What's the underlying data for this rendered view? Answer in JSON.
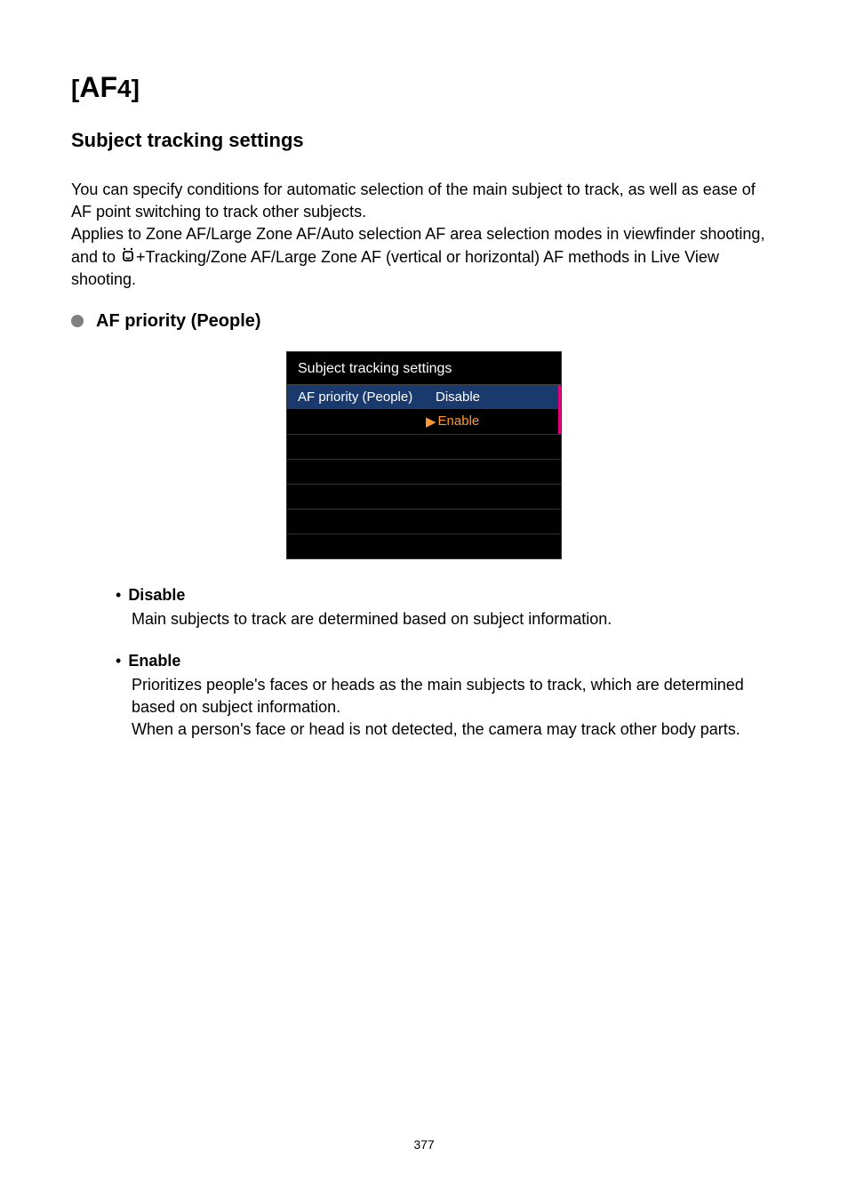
{
  "title": {
    "bracket_open": "[",
    "af": "AF",
    "num": "4",
    "bracket_close": "]"
  },
  "section_heading": "Subject tracking settings",
  "intro_para1": "You can specify conditions for automatic selection of the main subject to track, as well as ease of AF point switching to track other subjects.",
  "intro_para2_a": "Applies to Zone AF/Large Zone AF/Auto selection AF area selection modes in viewfinder shooting, and to ",
  "intro_para2_b": "+Tracking/Zone AF/Large Zone AF (vertical or horizontal) AF methods in Live View shooting.",
  "subsection_title": "AF priority (People)",
  "camera_menu": {
    "title": "Subject tracking settings",
    "row_label": "AF priority (People)",
    "option_disable": "Disable",
    "option_enable": "Enable"
  },
  "options": [
    {
      "name": "Disable",
      "desc": "Main subjects to track are determined based on subject information."
    },
    {
      "name": "Enable",
      "desc": "Prioritizes people's faces or heads as the main subjects to track, which are determined based on subject information.\nWhen a person's face or head is not detected, the camera may track other body parts."
    }
  ],
  "page_number": "377"
}
